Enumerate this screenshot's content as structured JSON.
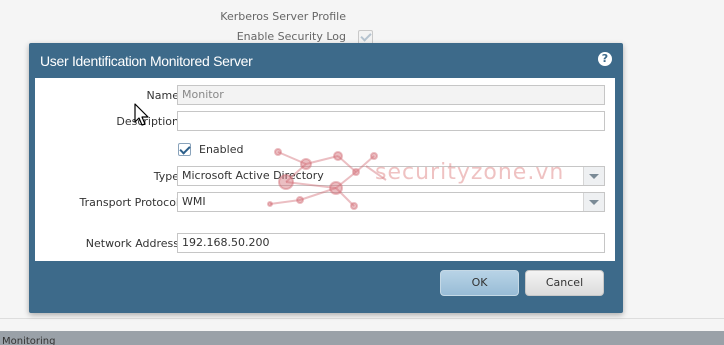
{
  "background": {
    "fields": [
      {
        "label": "Kerberos Server Profile"
      },
      {
        "label": "Enable Security Log",
        "checked": true
      }
    ],
    "bottom_section_label": "Monitoring"
  },
  "dialog": {
    "title": "User Identification Monitored Server",
    "help_icon": "question-circle-icon",
    "name": {
      "label": "Name",
      "value": "Monitor"
    },
    "description": {
      "label": "Description",
      "value": ""
    },
    "enabled": {
      "label": "Enabled",
      "checked": true
    },
    "type": {
      "label": "Type",
      "value": "Microsoft Active Directory"
    },
    "transport_protocol": {
      "label": "Transport Protocol",
      "value": "WMI"
    },
    "network_address": {
      "label": "Network Address",
      "value": "192.168.50.200"
    },
    "ok_label": "OK",
    "cancel_label": "Cancel"
  },
  "watermark": {
    "text": "securityzone.vn"
  },
  "colors": {
    "dialog_frame": "#3d6a8a",
    "ok_button": "#a9c8de",
    "watermark": "#dc7878"
  }
}
